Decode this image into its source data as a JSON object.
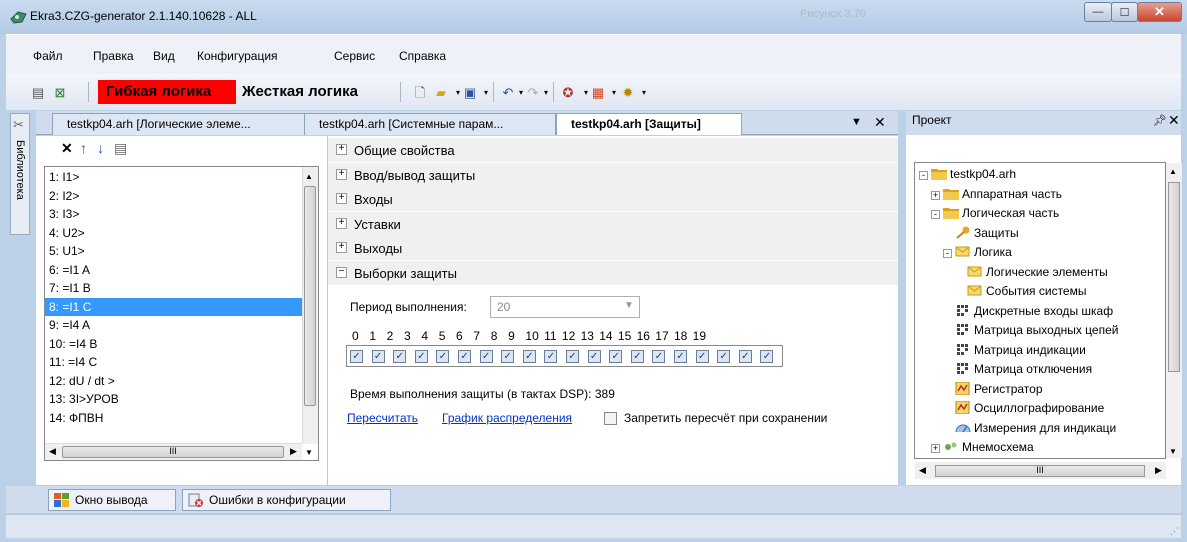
{
  "window": {
    "title": "Ekra3.CZG-generator 2.1.140.10628 - ALL",
    "ghost_title": "Рисунок 3.70"
  },
  "menu": [
    "Файл",
    "Правка",
    "Вид",
    "Конфигурация",
    "Сервис",
    "Справка"
  ],
  "toolbar": {
    "flex_logic": "Гибкая логика",
    "hard_logic": "Жесткая логика"
  },
  "library_tab": "Библиотека",
  "tabs": [
    {
      "label": "testkp04.arh [Логические элеме..."
    },
    {
      "label": "testkp04.arh [Системные парам..."
    },
    {
      "label": "testkp04.arh [Защиты]"
    }
  ],
  "list": {
    "items": [
      "1: I1>",
      "2: I2>",
      "3: I3>",
      "4: U2>",
      "5: U1>",
      "6: =I1 A",
      "7: =I1 B",
      "8: =I1 C",
      "9: =I4 A",
      "10: =I4 B",
      "11: =I4 C",
      "12: dU / dt >",
      "13: 3I>УРОВ",
      "14: ФПВН"
    ],
    "selected_index": 7,
    "hscroll_glyph": "III"
  },
  "groups": [
    {
      "label": "Общие свойства",
      "expanded": false
    },
    {
      "label": "Ввод/вывод защиты",
      "expanded": false
    },
    {
      "label": "Входы",
      "expanded": false
    },
    {
      "label": "Уставки",
      "expanded": false
    },
    {
      "label": "Выходы",
      "expanded": false
    },
    {
      "label": "Выборки защиты",
      "expanded": true
    }
  ],
  "samples": {
    "period_label": "Период выполнения:",
    "period_value": "20",
    "numbers": "0  1  2  3  4  5  6  7  8  9  10 11 12 13 14 15 16 17 18 19",
    "checked": [
      true,
      true,
      true,
      true,
      true,
      true,
      true,
      true,
      true,
      true,
      true,
      true,
      true,
      true,
      true,
      true,
      true,
      true,
      true,
      true
    ],
    "time_label": "Время выполнения защиты (в тактах DSP): 389",
    "recalc_link": "Пересчитать",
    "graph_link": "График распределения",
    "forbid_label": "Запретить пересчёт при сохранении",
    "forbid_checked": false
  },
  "project": {
    "title": "Проект",
    "tree": [
      {
        "label": "testkp04.arh",
        "level": 0,
        "icon": "folder-icon",
        "exp": "-"
      },
      {
        "label": "Аппаратная часть",
        "level": 1,
        "icon": "folder-icon",
        "exp": "+"
      },
      {
        "label": "Логическая часть",
        "level": 1,
        "icon": "folder-icon",
        "exp": "-"
      },
      {
        "label": "Защиты",
        "level": 2,
        "icon": "key-icon",
        "exp": ""
      },
      {
        "label": "Логика",
        "level": 2,
        "icon": "envelope-icon",
        "exp": "-"
      },
      {
        "label": "Логические элементы",
        "level": 3,
        "icon": "envelope-icon",
        "exp": ""
      },
      {
        "label": "События системы",
        "level": 3,
        "icon": "envelope-icon",
        "exp": ""
      },
      {
        "label": "Дискретные входы шкаф",
        "level": 2,
        "icon": "matrix-icon",
        "exp": ""
      },
      {
        "label": "Матрица выходных цепей",
        "level": 2,
        "icon": "matrix-icon",
        "exp": ""
      },
      {
        "label": "Матрица индикации",
        "level": 2,
        "icon": "matrix-icon",
        "exp": ""
      },
      {
        "label": "Матрица отключения",
        "level": 2,
        "icon": "matrix-icon",
        "exp": ""
      },
      {
        "label": "Регистратор",
        "level": 2,
        "icon": "recorder-icon",
        "exp": ""
      },
      {
        "label": "Осциллографирование",
        "level": 2,
        "icon": "recorder-icon",
        "exp": ""
      },
      {
        "label": "Измерения для индикаци",
        "level": 2,
        "icon": "gauge-icon",
        "exp": ""
      },
      {
        "label": "Мнемосхема",
        "level": 1,
        "icon": "scheme-icon",
        "exp": "+"
      }
    ],
    "hscroll_glyph": "III"
  },
  "bottom_tabs": [
    "Окно вывода",
    "Ошибки в конфигурации"
  ],
  "colors": {
    "flex_logic_bg": "#ff0000",
    "selection": "#3399ff",
    "link": "#0033cc"
  }
}
